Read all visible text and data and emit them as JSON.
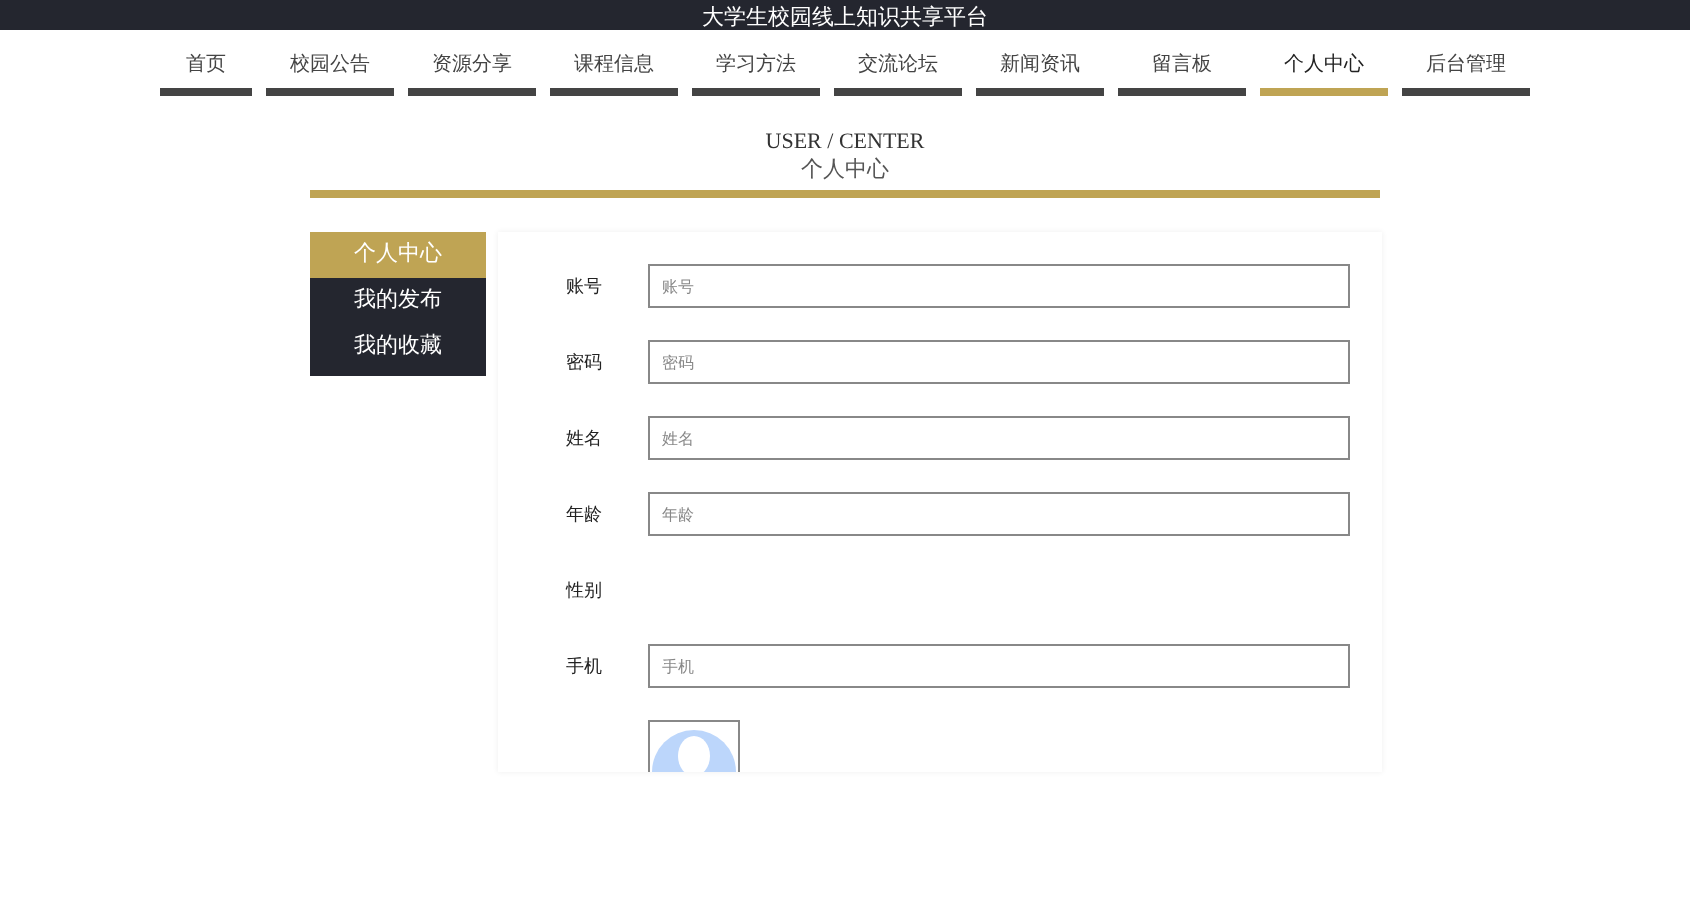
{
  "site_title": "大学生校园线上知识共享平台",
  "nav": [
    {
      "label": "首页",
      "selected": false
    },
    {
      "label": "校园公告",
      "selected": false
    },
    {
      "label": "资源分享",
      "selected": false
    },
    {
      "label": "课程信息",
      "selected": false
    },
    {
      "label": "学习方法",
      "selected": false
    },
    {
      "label": "交流论坛",
      "selected": false
    },
    {
      "label": "新闻资讯",
      "selected": false
    },
    {
      "label": "留言板",
      "selected": false
    },
    {
      "label": "个人中心",
      "selected": true
    },
    {
      "label": "后台管理",
      "selected": false
    }
  ],
  "section": {
    "title_en": "USER / CENTER",
    "title_cn": "个人中心"
  },
  "sidebar": [
    {
      "label": "个人中心",
      "selected": true
    },
    {
      "label": "我的发布",
      "selected": false
    },
    {
      "label": "我的收藏",
      "selected": false
    }
  ],
  "form": [
    {
      "kind": "input",
      "label": "账号",
      "placeholder": "账号"
    },
    {
      "kind": "input",
      "label": "密码",
      "placeholder": "密码"
    },
    {
      "kind": "input",
      "label": "姓名",
      "placeholder": "姓名"
    },
    {
      "kind": "input",
      "label": "年龄",
      "placeholder": "年龄"
    },
    {
      "kind": "radio",
      "label": "性别"
    },
    {
      "kind": "input",
      "label": "手机",
      "placeholder": "手机"
    },
    {
      "kind": "avatar"
    }
  ]
}
